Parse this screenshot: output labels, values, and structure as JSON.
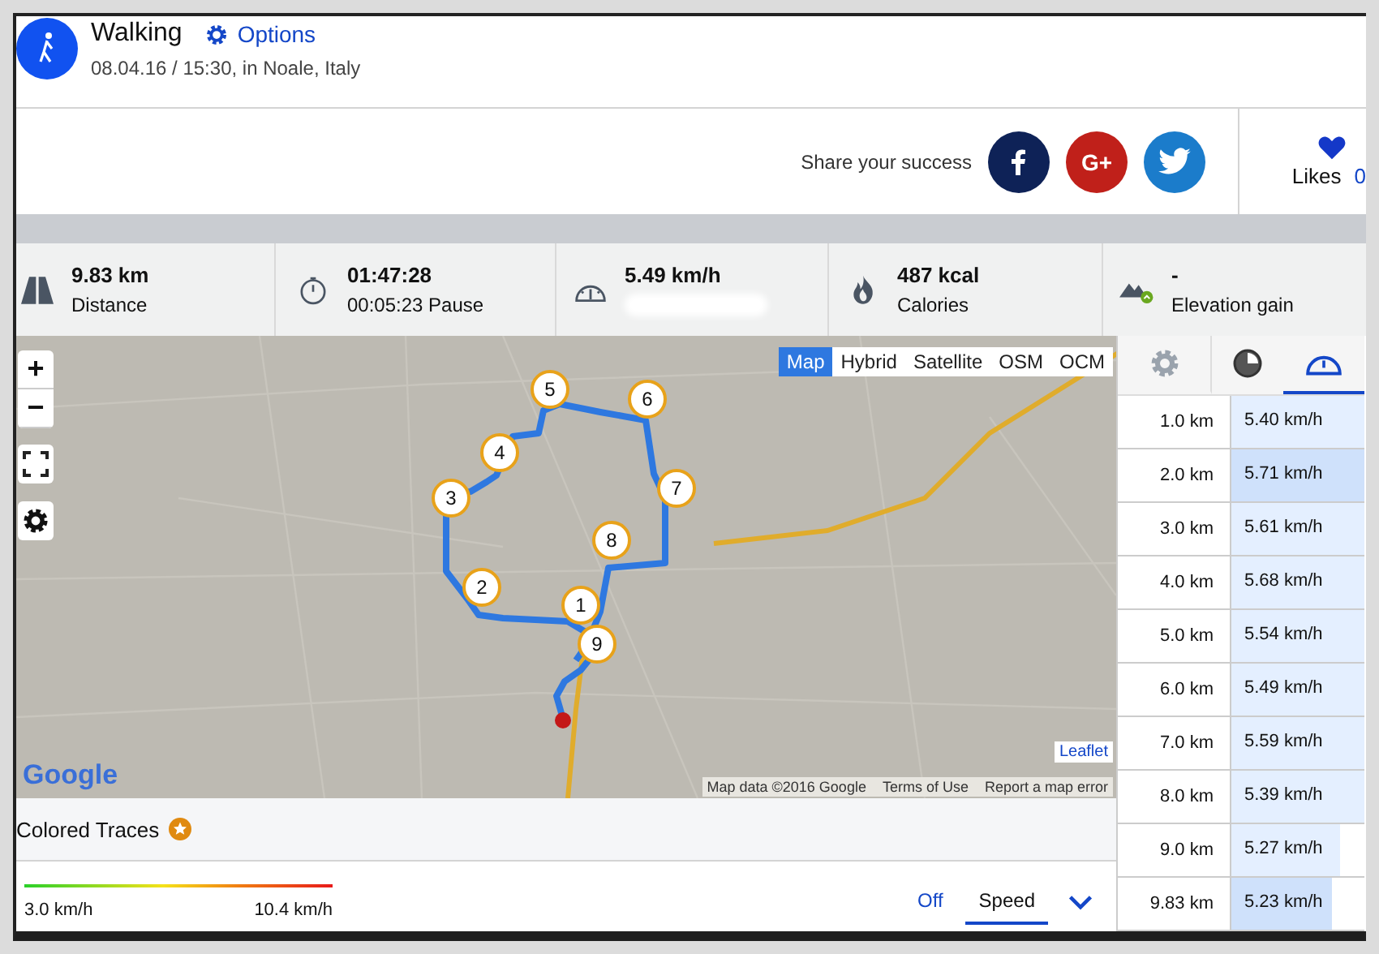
{
  "activity": {
    "title": "Walking",
    "options_link": "Options",
    "subtitle": "08.04.16 / 15:30, in Noale, Italy"
  },
  "share": {
    "label": "Share your success",
    "buttons": [
      {
        "kind": "facebook"
      },
      {
        "kind": "googleplus",
        "text": "G+"
      },
      {
        "kind": "twitter"
      }
    ],
    "likes_label": "Likes",
    "likes_count": "0"
  },
  "stats": [
    {
      "kind": "distance",
      "value": "9.83 km",
      "label": "Distance"
    },
    {
      "kind": "timer",
      "value": "01:47:28",
      "label": "00:05:23 Pause"
    },
    {
      "kind": "speed",
      "value": "5.49 km/h"
    },
    {
      "kind": "calories",
      "value": "487 kcal",
      "label": "Calories"
    },
    {
      "kind": "elevation",
      "value": "-",
      "label": "Elevation gain"
    }
  ],
  "map": {
    "zoom_in": "+",
    "zoom_out": "−",
    "layers": [
      {
        "label": "Map",
        "selected": true
      },
      {
        "label": "Hybrid",
        "selected": false
      },
      {
        "label": "Satellite",
        "selected": false
      },
      {
        "label": "OSM",
        "selected": false
      },
      {
        "label": "OCM",
        "selected": false
      }
    ],
    "markers": [
      "1",
      "2",
      "3",
      "4",
      "5",
      "6",
      "7",
      "8",
      "9"
    ],
    "logo": "Google",
    "attribution": [
      "Map data ©2016 Google",
      "Terms of Use",
      "Report a map error"
    ],
    "leaflet_link": "Leaflet"
  },
  "side_tabs": [
    {
      "kind": "settings",
      "selected": false
    },
    {
      "kind": "pie",
      "selected": false
    },
    {
      "kind": "speed",
      "selected": true
    }
  ],
  "splits": [
    {
      "distance": "1.0 km",
      "speed": "5.40 km/h",
      "level": 1,
      "highlight": false
    },
    {
      "distance": "2.0 km",
      "speed": "5.71 km/h",
      "level": 1,
      "highlight": true
    },
    {
      "distance": "3.0 km",
      "speed": "5.61 km/h",
      "level": 1,
      "highlight": false
    },
    {
      "distance": "4.0 km",
      "speed": "5.68 km/h",
      "level": 1,
      "highlight": false
    },
    {
      "distance": "5.0 km",
      "speed": "5.54 km/h",
      "level": 1,
      "highlight": false
    },
    {
      "distance": "6.0 km",
      "speed": "5.49 km/h",
      "level": 1,
      "highlight": false
    },
    {
      "distance": "7.0 km",
      "speed": "5.59 km/h",
      "level": 1,
      "highlight": false
    },
    {
      "distance": "8.0 km",
      "speed": "5.39 km/h",
      "level": 1,
      "highlight": false
    },
    {
      "distance": "9.0 km",
      "speed": "5.27 km/h",
      "level": 0.82,
      "highlight": false
    },
    {
      "distance": "9.83 km",
      "speed": "5.23 km/h",
      "level": 0.76,
      "highlight": true
    }
  ],
  "colored_traces": {
    "title": "Colored Traces",
    "legend_min": "3.0 km/h",
    "legend_max": "10.4 km/h",
    "options": [
      {
        "label": "Off",
        "selected": false
      },
      {
        "label": "Speed",
        "selected": true
      }
    ]
  }
}
